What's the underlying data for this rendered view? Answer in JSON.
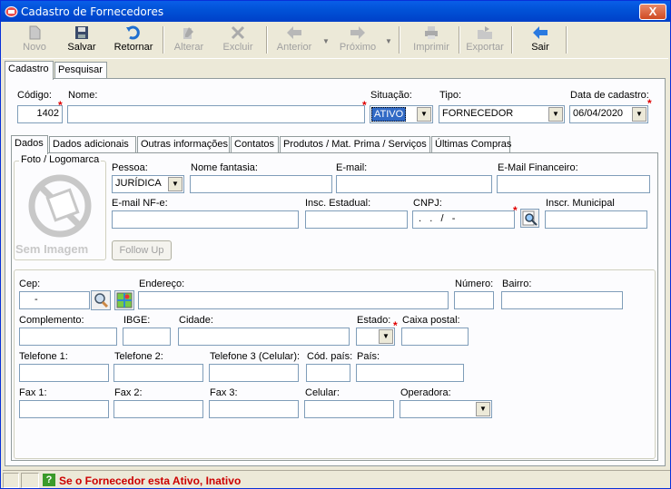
{
  "window": {
    "title": "Cadastro de Fornecedores",
    "close_label": "X"
  },
  "toolbar": {
    "novo": "Novo",
    "salvar": "Salvar",
    "retornar": "Retornar",
    "alterar": "Alterar",
    "excluir": "Excluir",
    "anterior": "Anterior",
    "proximo": "Próximo",
    "imprimir": "Imprimir",
    "exportar": "Exportar",
    "sair": "Sair"
  },
  "main_tabs": {
    "cadastro": "Cadastro",
    "pesquisar": "Pesquisar"
  },
  "header": {
    "codigo_label": "Código:",
    "codigo_value": "1402",
    "nome_label": "Nome:",
    "nome_value": "",
    "situacao_label": "Situação:",
    "situacao_value": "ATIVO",
    "tipo_label": "Tipo:",
    "tipo_value": "FORNECEDOR",
    "data_label": "Data de cadastro:",
    "data_value": "06/04/2020"
  },
  "sub_tabs": {
    "dados": "Dados",
    "adicionais": "Dados adicionais",
    "outras": "Outras informações",
    "contatos": "Contatos",
    "produtos": "Produtos / Mat. Prima / Serviços",
    "compras": "Últimas Compras"
  },
  "foto": {
    "label": "Foto / Logomarca",
    "placeholder": "Sem Imagem",
    "followup": "Follow Up"
  },
  "dados": {
    "pessoa_label": "Pessoa:",
    "pessoa_value": "JURÍDICA",
    "fantasia_label": "Nome fantasia:",
    "email_label": "E-mail:",
    "email_fin_label": "E-Mail Financeiro:",
    "email_nfe_label": "E-mail NF-e:",
    "insc_est_label": "Insc. Estadual:",
    "cnpj_label": "CNPJ:",
    "cnpj_value": " .   .   /   -",
    "insc_mun_label": "Inscr. Municipal"
  },
  "endereco": {
    "cep_label": "Cep:",
    "cep_value": "-",
    "endereco_label": "Endereço:",
    "numero_label": "Número:",
    "bairro_label": "Bairro:",
    "complemento_label": "Complemento:",
    "ibge_label": "IBGE:",
    "cidade_label": "Cidade:",
    "estado_label": "Estado:",
    "caixa_label": "Caixa postal:",
    "tel1_label": "Telefone 1:",
    "tel2_label": "Telefone 2:",
    "tel3_label": "Telefone 3 (Celular):",
    "codpais_label": "Cód. país:",
    "pais_label": "País:",
    "fax1_label": "Fax 1:",
    "fax2_label": "Fax 2:",
    "fax3_label": "Fax 3:",
    "celular_label": "Celular:",
    "operadora_label": "Operadora:"
  },
  "status": {
    "message": "Se o Fornecedor esta Ativo, Inativo",
    "help_icon": "?"
  },
  "colors": {
    "status_text": "#cc0000",
    "selected_value_bg": "#316ac5"
  }
}
